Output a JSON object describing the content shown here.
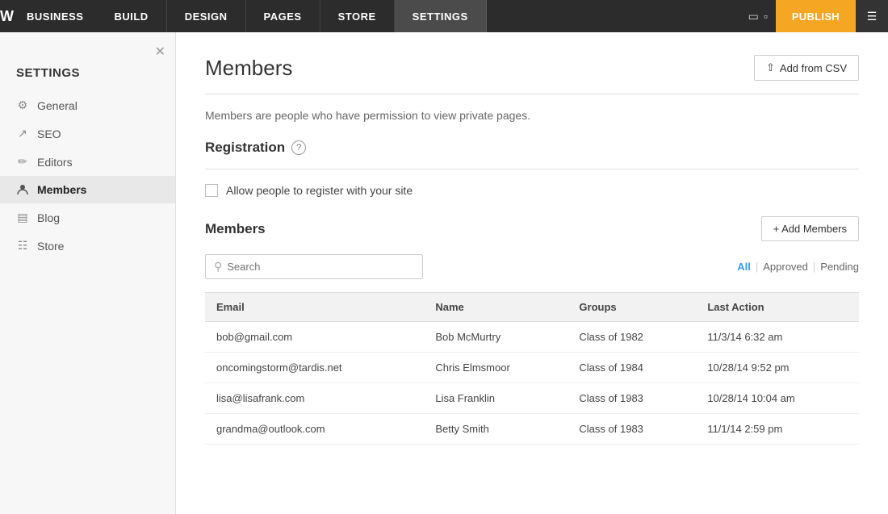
{
  "topNav": {
    "logo": "W",
    "businessLabel": "BUSINESS",
    "items": [
      {
        "label": "BUILD",
        "id": "build"
      },
      {
        "label": "DESIGN",
        "id": "design"
      },
      {
        "label": "PAGES",
        "id": "pages"
      },
      {
        "label": "STORE",
        "id": "store"
      },
      {
        "label": "SETTINGS",
        "id": "settings",
        "active": true
      }
    ],
    "publishLabel": "PUBLISH"
  },
  "sidebar": {
    "title": "SETTINGS",
    "items": [
      {
        "id": "general",
        "label": "General",
        "icon": "⚙"
      },
      {
        "id": "seo",
        "label": "SEO",
        "icon": "↗"
      },
      {
        "id": "editors",
        "label": "Editors",
        "icon": "✏"
      },
      {
        "id": "members",
        "label": "Members",
        "icon": "👤",
        "active": true
      },
      {
        "id": "blog",
        "label": "Blog",
        "icon": "💬"
      },
      {
        "id": "store",
        "label": "Store",
        "icon": "🛒"
      }
    ]
  },
  "main": {
    "pageTitle": "Members",
    "addFromCsvLabel": "Add from CSV",
    "description": "Members are people who have permission to view private pages.",
    "registration": {
      "title": "Registration",
      "helpIcon": "?",
      "checkboxLabel": "Allow people to register with your site"
    },
    "membersSection": {
      "title": "Members",
      "addMembersLabel": "+ Add Members",
      "search": {
        "placeholder": "Search"
      },
      "filters": [
        {
          "label": "All",
          "active": true
        },
        {
          "label": "Approved",
          "active": false
        },
        {
          "label": "Pending",
          "active": false
        }
      ],
      "tableHeaders": [
        "Email",
        "Name",
        "Groups",
        "Last Action"
      ],
      "rows": [
        {
          "email": "bob@gmail.com",
          "name": "Bob McMurtry",
          "groups": "Class of 1982",
          "lastAction": "11/3/14 6:32 am"
        },
        {
          "email": "oncomingstorm@tardis.net",
          "name": "Chris Elmsmoor",
          "groups": "Class of 1984",
          "lastAction": "10/28/14 9:52 pm"
        },
        {
          "email": "lisa@lisafrank.com",
          "name": "Lisa Franklin",
          "groups": "Class of 1983",
          "lastAction": "10/28/14 10:04 am"
        },
        {
          "email": "grandma@outlook.com",
          "name": "Betty Smith",
          "groups": "Class of 1983",
          "lastAction": "11/1/14 2:59 pm"
        }
      ]
    }
  }
}
